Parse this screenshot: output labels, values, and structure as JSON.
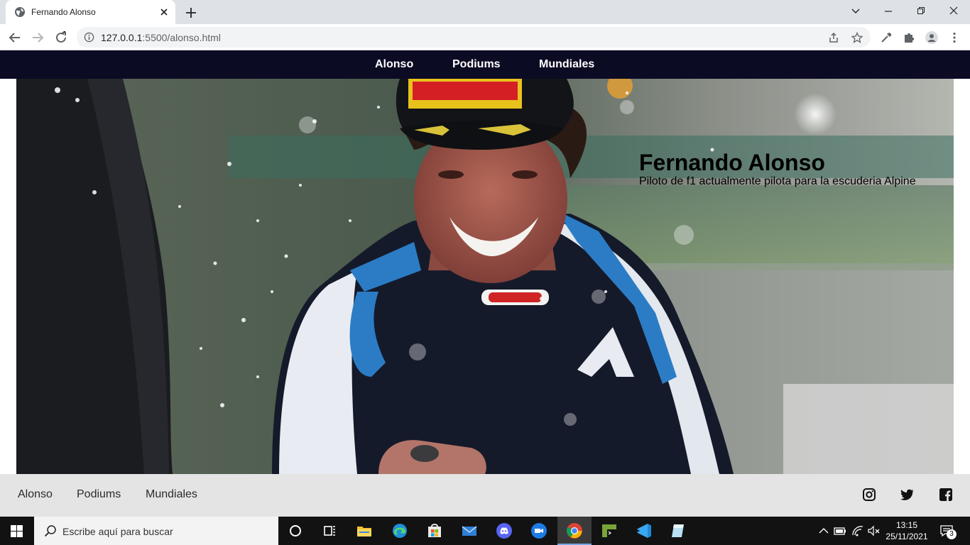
{
  "browser": {
    "tab_title": "Fernando Alonso",
    "url_host": "127.0.0.1",
    "url_path": ":5500/alonso.html"
  },
  "nav": {
    "items": [
      {
        "label": "Alonso"
      },
      {
        "label": "Podiums"
      },
      {
        "label": "Mundiales"
      }
    ]
  },
  "hero": {
    "title": "Fernando Alonso",
    "subtitle": "Piloto de f1 actualmente pilota para la escuderia Alpine",
    "image_icon": "driver-celebration-photo"
  },
  "footer": {
    "links": [
      {
        "label": "Alonso"
      },
      {
        "label": "Podiums"
      },
      {
        "label": "Mundiales"
      }
    ],
    "social_icons": [
      "instagram-icon",
      "twitter-icon",
      "facebook-icon"
    ]
  },
  "taskbar": {
    "search_placeholder": "Escribe aquí para buscar",
    "time": "13:15",
    "date": "25/11/2021",
    "notification_count": "3"
  },
  "colors": {
    "nav_bg": "#0c0b24",
    "footer_bg": "#e4e4e4",
    "taskbar_bg": "#121212"
  }
}
